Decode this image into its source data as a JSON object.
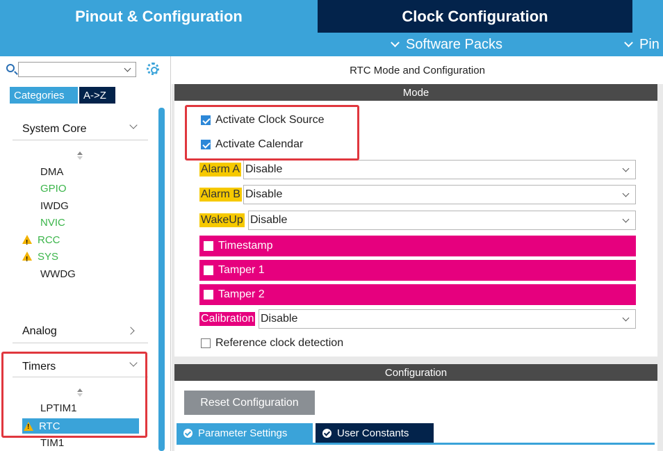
{
  "top_tabs": {
    "pinout": "Pinout & Configuration",
    "clock": "Clock Configuration"
  },
  "sub_menu": {
    "software_packs": "Software Packs",
    "pinout_partial": "Pin"
  },
  "sidebar": {
    "search_placeholder": "",
    "tabs": {
      "categories": "Categories",
      "az": "A->Z"
    },
    "system_core": {
      "title": "System Core",
      "items": [
        "DMA",
        "GPIO",
        "IWDG",
        "NVIC",
        "RCC",
        "SYS",
        "WWDG"
      ]
    },
    "analog": {
      "title": "Analog"
    },
    "timers": {
      "title": "Timers",
      "items": [
        "LPTIM1",
        "RTC",
        "TIM1"
      ]
    }
  },
  "main": {
    "title": "RTC Mode and Configuration",
    "mode_header": "Mode",
    "activate_clock_source": "Activate Clock Source",
    "activate_calendar": "Activate Calendar",
    "alarm_a_label": "Alarm A",
    "alarm_a_value": "Disable",
    "alarm_b_label": "Alarm B",
    "alarm_b_value": "Disable",
    "wakeup_label": "WakeUp",
    "wakeup_value": "Disable",
    "timestamp": "Timestamp",
    "tamper1": "Tamper 1",
    "tamper2": "Tamper 2",
    "calibration_label": "Calibration",
    "calibration_value": "Disable",
    "reference_clock": "Reference clock detection",
    "config_header": "Configuration",
    "reset_button": "Reset Configuration",
    "tab_params": "Parameter Settings",
    "tab_constants": "User Constants"
  },
  "colors": {
    "accent_blue": "#3aa3d9",
    "dark_navy": "#03234b",
    "pink": "#e6007e",
    "yellow": "#f6c900",
    "highlight_red": "#e0373e"
  }
}
